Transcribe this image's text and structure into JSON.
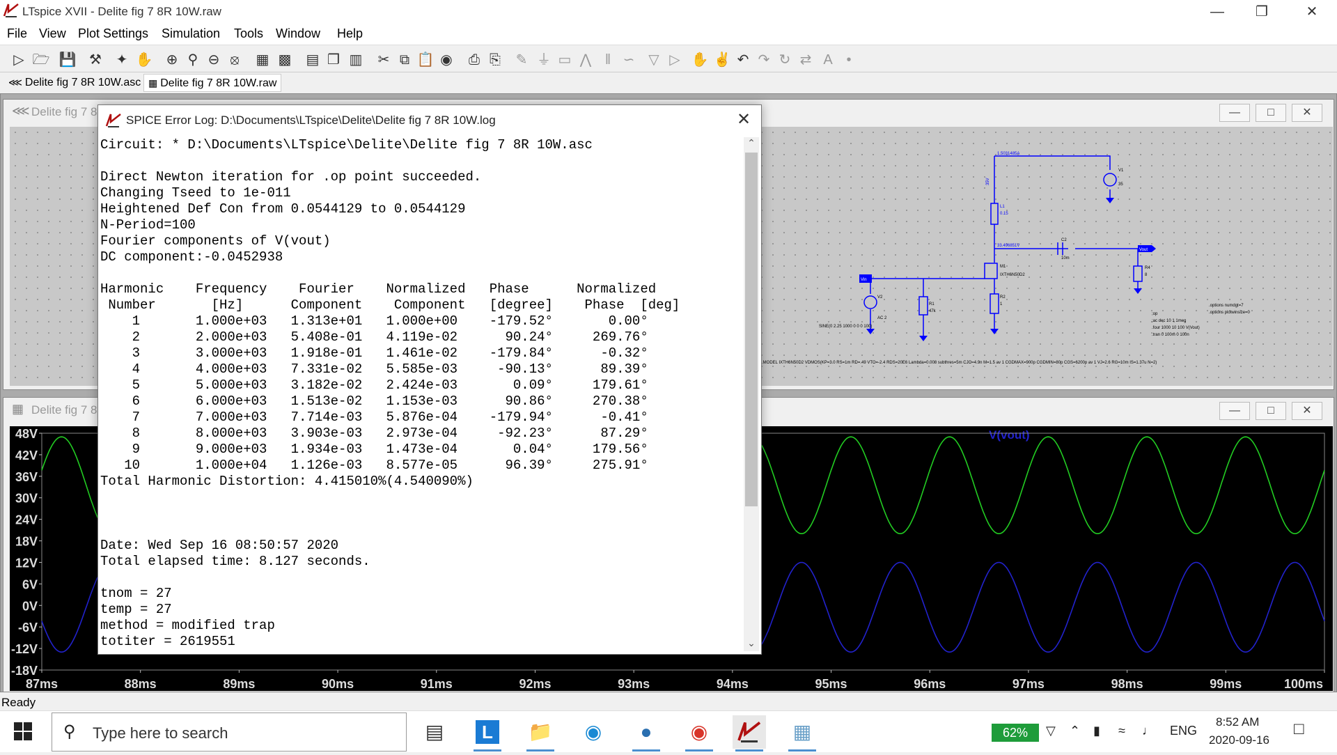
{
  "window": {
    "title": "LTspice XVII - Delite fig 7 8R 10W.raw"
  },
  "menu": [
    "File",
    "View",
    "Plot Settings",
    "Simulation",
    "Tools",
    "Window",
    "Help"
  ],
  "tabs": [
    {
      "label": "Delite fig 7 8R 10W.asc"
    },
    {
      "label": "Delite fig 7 8R 10W.raw"
    }
  ],
  "schematic_window": {
    "title": "Delite fig 7 8"
  },
  "plot_window": {
    "title": "Delite fig 7 8"
  },
  "schematic": {
    "current_label": "1.5031485A",
    "node_label": "33.496851V",
    "v35": "35V",
    "l1": "L1",
    "l1v": "0.15",
    "c2": "C2",
    "c2v": "10m",
    "v1": "V1",
    "v1v": "35",
    "vout": "Vout",
    "r4": "R4",
    "r4v": "8",
    "m1": "M1",
    "m1v": "IXTH6N50D2",
    "r2": "R2",
    "r2v": "1",
    "vin": "Vin",
    "v2": "V2",
    "v2v": "AC 2",
    "r1": "R1",
    "r1v": "47k",
    "sine": "SINE(0 2.25 1000 0 0 0 100)",
    "op": ";op",
    "ac": ";ac dec 10 1 1meg",
    "four": ".four 1000 10 100 V(Vout)",
    "tran": ".tran 0 100m 0 100n",
    "opt1": ".options numdgt=7",
    "opt2": ".options plotwinsize=0",
    "model": ".MODEL IXTH6N50D2 VDMOS(KP=3.0 RS=1m RD=.49 VTO=-2.4 RDS=20E6 Lambda=0.008 subthres=5m CJO=4.9n M=1.5 av 1 CGDMAX=900p CGDMIN=80p CGS=6200p av 1 VJ=2.6 RG=10m IS=1.37u N=2)"
  },
  "dialog": {
    "title": "SPICE Error Log: D:\\Documents\\LTspice\\Delite\\Delite fig 7 8R 10W.log",
    "lines": [
      "Circuit: * D:\\Documents\\LTspice\\Delite\\Delite fig 7 8R 10W.asc",
      "",
      "Direct Newton iteration for .op point succeeded.",
      "Changing Tseed to 1e-011",
      "Heightened Def Con from 0.0544129 to 0.0544129",
      "N-Period=100",
      "Fourier components of V(vout)",
      "DC component:-0.0452938",
      "",
      "Harmonic    Frequency    Fourier    Normalized   Phase      Normalized",
      " Number       [Hz]      Component    Component   [degree]    Phase  [deg]",
      "    1       1.000e+03   1.313e+01   1.000e+00    -179.52°       0.00°",
      "    2       2.000e+03   5.408e-01   4.119e-02      90.24°     269.76°",
      "    3       3.000e+03   1.918e-01   1.461e-02    -179.84°      -0.32°",
      "    4       4.000e+03   7.331e-02   5.585e-03     -90.13°      89.39°",
      "    5       5.000e+03   3.182e-02   2.424e-03       0.09°     179.61°",
      "    6       6.000e+03   1.513e-02   1.153e-03      90.86°     270.38°",
      "    7       7.000e+03   7.714e-03   5.876e-04    -179.94°      -0.41°",
      "    8       8.000e+03   3.903e-03   2.973e-04     -92.23°      87.29°",
      "    9       9.000e+03   1.934e-03   1.473e-04       0.04°     179.56°",
      "   10       1.000e+04   1.126e-03   8.577e-05      96.39°     275.91°",
      "Total Harmonic Distortion: 4.415010%(4.540090%)",
      "",
      "",
      "",
      "Date: Wed Sep 16 08:50:57 2020",
      "Total elapsed time: 8.127 seconds.",
      "",
      "tnom = 27",
      "temp = 27",
      "method = modified trap",
      "totiter = 2619551"
    ]
  },
  "plot": {
    "trace_label": "V(vout)",
    "green_color": "#22cc22",
    "blue_color": "#2222cc"
  },
  "chart_data": {
    "type": "line",
    "title": "V(vout)",
    "xlabel": "",
    "ylabel": "",
    "x_ticks": [
      "87ms",
      "88ms",
      "89ms",
      "90ms",
      "91ms",
      "92ms",
      "93ms",
      "94ms",
      "95ms",
      "96ms",
      "97ms",
      "98ms",
      "99ms",
      "100ms"
    ],
    "y_ticks": [
      "48V",
      "42V",
      "36V",
      "30V",
      "24V",
      "18V",
      "12V",
      "6V",
      "0V",
      "-6V",
      "-12V",
      "-18V"
    ],
    "xlim": [
      87,
      100
    ],
    "ylim": [
      -18,
      48
    ],
    "series": [
      {
        "name": "V(vout)",
        "frequency_khz": 1,
        "min": 20,
        "max": 47,
        "peak_at_ms": 87.2,
        "color": "#22cc22"
      },
      {
        "frequency_khz": 1,
        "min": -13,
        "max": 12,
        "peak_at_ms": 87.7,
        "color": "#2222cc"
      }
    ]
  },
  "status": {
    "text": "Ready"
  },
  "taskbar": {
    "search_placeholder": "Type here to search",
    "battery": "62%",
    "lang": "ENG",
    "time": "8:52 AM",
    "date": "2020-09-16"
  }
}
